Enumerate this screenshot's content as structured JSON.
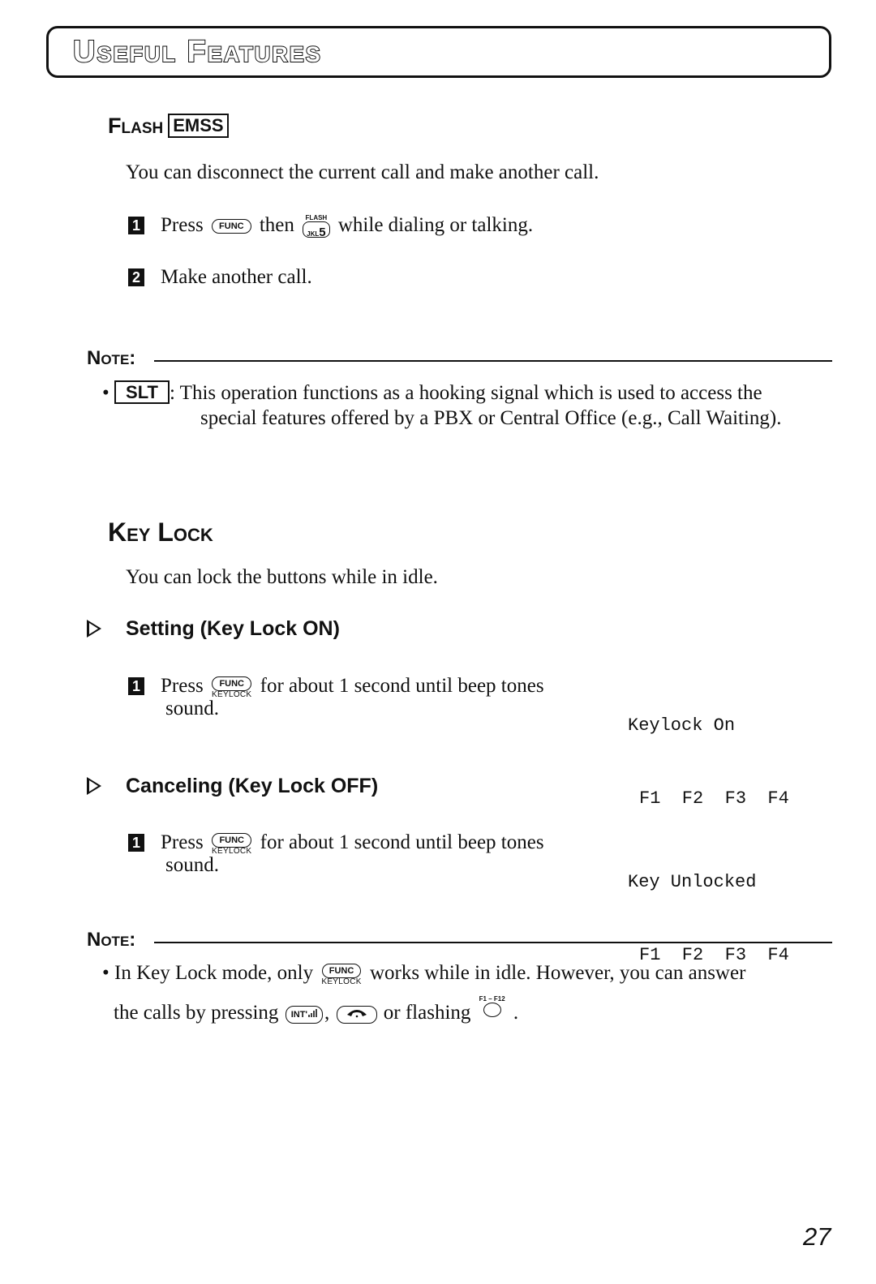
{
  "header": {
    "title": "Useful Features"
  },
  "flash": {
    "title": "Flash",
    "tag": "EMSS",
    "intro": "You can disconnect the current call and make another call.",
    "steps": [
      {
        "num": "1",
        "prefix": "Press",
        "key1": "FUNC",
        "middle": "then",
        "key2_super": "FLASH",
        "key2_letters": "JKL",
        "key2_digit": "5",
        "suffix": "while dialing or talking."
      },
      {
        "num": "2",
        "text": "Make another call."
      }
    ],
    "note": {
      "label": "Note:",
      "tag": "SLT",
      "line1": ": This operation functions as a hooking signal which is used to access the",
      "line2": "special features offered by a PBX or Central Office (e.g., Call Waiting)."
    }
  },
  "keylock": {
    "title": "Key Lock",
    "intro": "You can lock the buttons while in idle.",
    "setting": {
      "heading": "Setting (Key Lock ON)",
      "step": {
        "num": "1",
        "prefix": "Press",
        "key_top": "FUNC",
        "key_bottom": "KEYLOCK",
        "text": "for about 1 second until beep tones",
        "text2": "sound."
      },
      "display": {
        "line1": "Keylock On",
        "line2": "F1  F2  F3  F4"
      }
    },
    "canceling": {
      "heading": "Canceling (Key Lock OFF)",
      "step": {
        "num": "1",
        "prefix": "Press",
        "key_top": "FUNC",
        "key_bottom": "KEYLOCK",
        "text": "for about 1 second until beep tones",
        "text2": "sound."
      },
      "display": {
        "line1": "Key Unlocked",
        "line2": "F1  F2  F3  F4"
      }
    },
    "note": {
      "label": "Note:",
      "line1_prefix": "In Key Lock mode, only",
      "key_top": "FUNC",
      "key_bottom": "KEYLOCK",
      "line1_suffix": "works while in idle. However, you can answer",
      "line2_prefix": "the calls by pressing",
      "key_int": "INT'",
      "sep": ",",
      "line2_mid": "or flashing",
      "flex_label": "F1 – F12",
      "end": "."
    }
  },
  "page_number": "27"
}
